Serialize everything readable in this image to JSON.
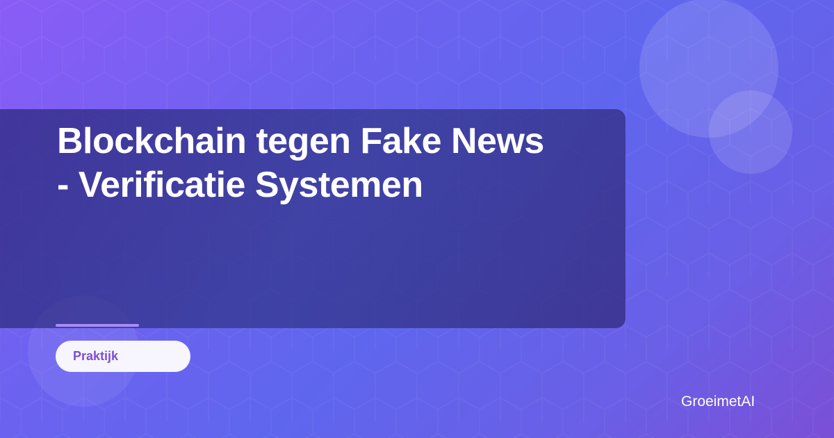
{
  "card": {
    "title": "Blockchain tegen Fake News - Verificatie Systemen",
    "category": "Praktijk",
    "brand": "GroeimetAI"
  },
  "colors": {
    "background_start": "#8b5cf6",
    "background_mid": "#5f66ee",
    "background_end": "#7b4fd6",
    "panel": "#2d2f82",
    "accent": "#a78bfa",
    "badge_bg": "#f7f5fd",
    "badge_text": "#7c4dd8",
    "text": "#ffffff"
  },
  "icons": [
    "hexagon-pattern",
    "decorative-circle"
  ]
}
